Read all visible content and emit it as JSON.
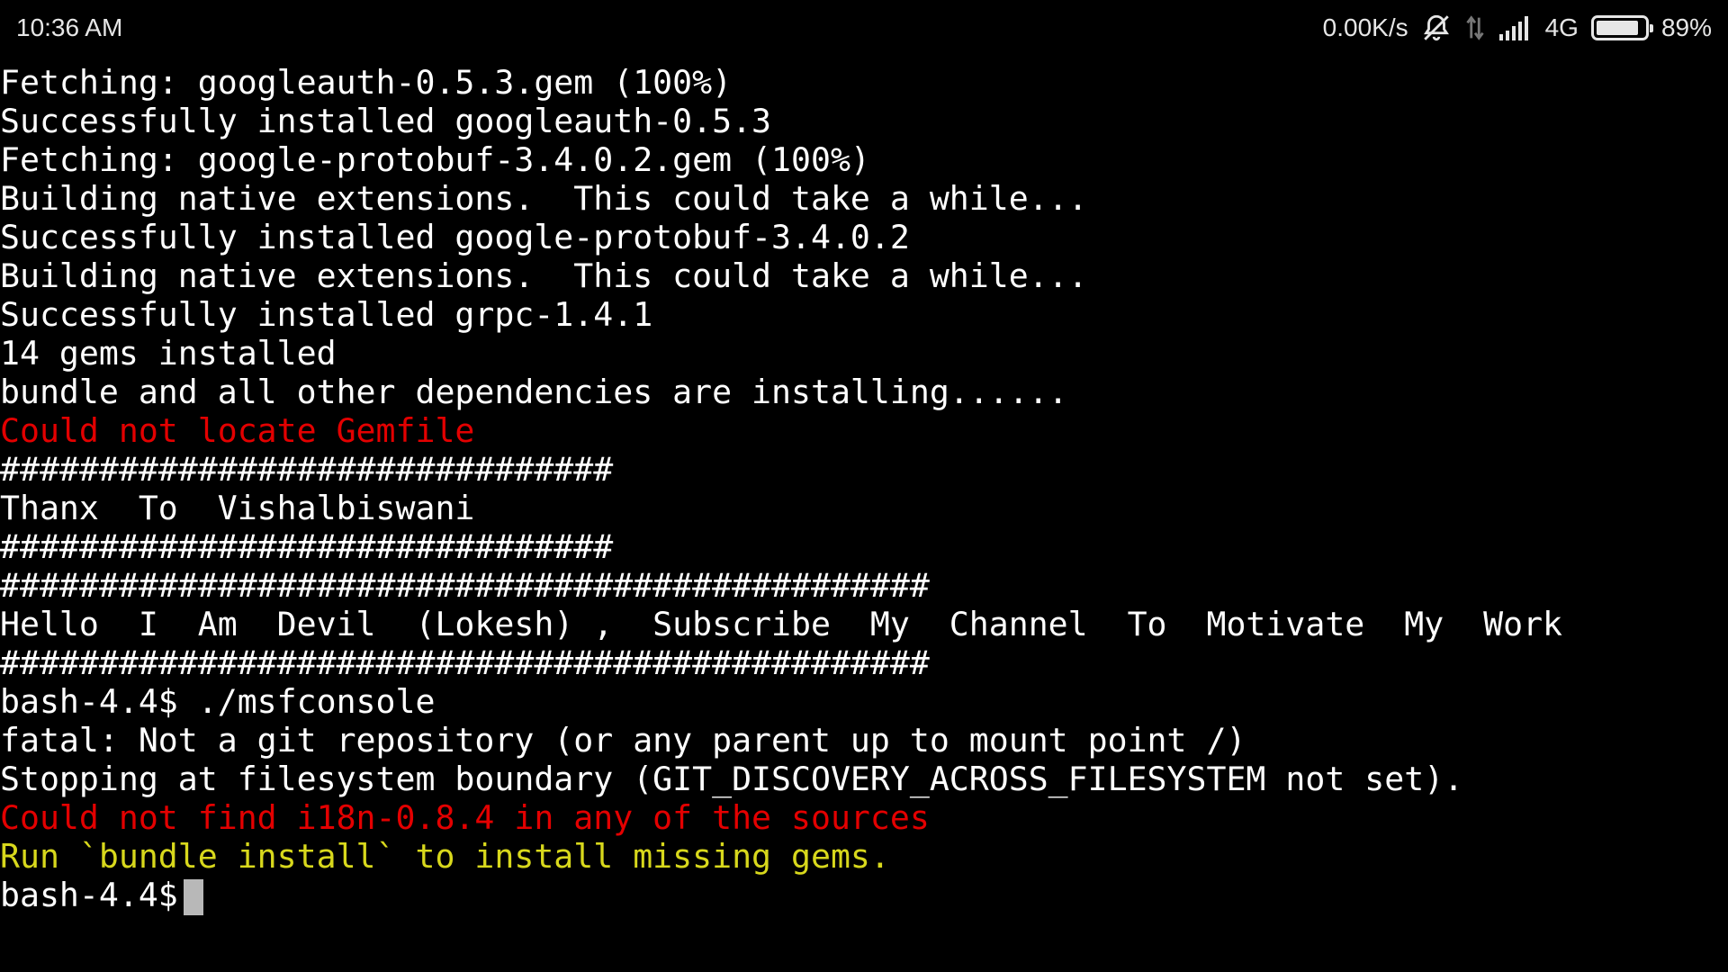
{
  "status_bar": {
    "time": "10:36 AM",
    "network_speed": "0.00K/s",
    "network_type": "4G",
    "battery_percent": "89%",
    "battery_level": 0.89,
    "icons": [
      "alarm-off-icon",
      "data-transfer-icon",
      "signal-icon",
      "battery-icon"
    ]
  },
  "terminal": {
    "lines": [
      {
        "text": "Fetching: googleauth-0.5.3.gem (100%)",
        "color": "#ffffff"
      },
      {
        "text": "Successfully installed googleauth-0.5.3",
        "color": "#ffffff"
      },
      {
        "text": "Fetching: google-protobuf-3.4.0.2.gem (100%)",
        "color": "#ffffff"
      },
      {
        "text": "Building native extensions.  This could take a while...",
        "color": "#ffffff"
      },
      {
        "text": "Successfully installed google-protobuf-3.4.0.2",
        "color": "#ffffff"
      },
      {
        "text": "Building native extensions.  This could take a while...",
        "color": "#ffffff"
      },
      {
        "text": "Successfully installed grpc-1.4.1",
        "color": "#ffffff"
      },
      {
        "text": "14 gems installed",
        "color": "#ffffff"
      },
      {
        "text": "bundle and all other dependencies are installing......",
        "color": "#ffffff"
      },
      {
        "text": "Could not locate Gemfile",
        "color": "#e30000"
      },
      {
        "text": "###############################",
        "color": "#ffffff"
      },
      {
        "text": "Thanx  To  Vishalbiswani",
        "color": "#ffffff"
      },
      {
        "text": "###############################",
        "color": "#ffffff"
      },
      {
        "text": "###############################################",
        "color": "#ffffff"
      },
      {
        "text": "Hello  I  Am  Devil  (Lokesh) ,  Subscribe  My  Channel  To  Motivate  My  Work",
        "color": "#ffffff"
      },
      {
        "text": "###############################################",
        "color": "#ffffff"
      },
      {
        "text": "bash-4.4$ ./msfconsole",
        "color": "#ffffff"
      },
      {
        "text": "fatal: Not a git repository (or any parent up to mount point /)",
        "color": "#ffffff"
      },
      {
        "text": "Stopping at filesystem boundary (GIT_DISCOVERY_ACROSS_FILESYSTEM not set).",
        "color": "#ffffff"
      },
      {
        "text": "Could not find i18n-0.8.4 in any of the sources",
        "color": "#e30000"
      },
      {
        "text": "Run `bundle install` to install missing gems.",
        "color": "#d8d81c"
      }
    ],
    "prompt": "bash-4.4$"
  },
  "colors": {
    "background": "#000000",
    "text": "#ffffff",
    "error": "#e30000",
    "warning": "#d8d81c",
    "cursor": "#b8b8b8"
  }
}
